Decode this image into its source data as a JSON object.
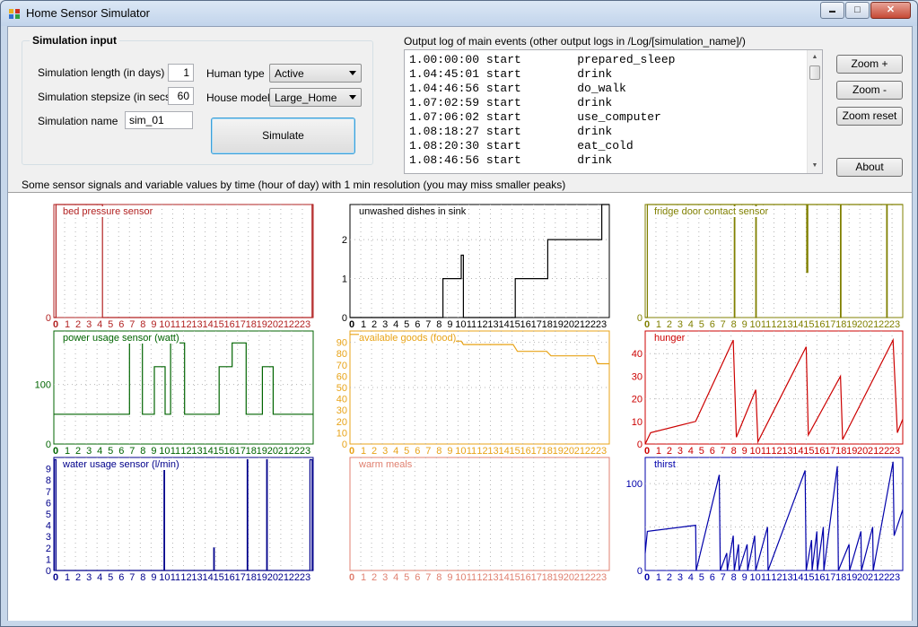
{
  "window": {
    "title": "Home Sensor Simulator",
    "minimize_glyph": "▬",
    "maximize_glyph": "□",
    "close_glyph": "✕",
    "icon": "app-icon"
  },
  "input": {
    "group_title": "Simulation input",
    "length_label": "Simulation length (in days)",
    "length_value": "1",
    "stepsize_label": "Simulation stepsize (in secs)",
    "stepsize_value": "60",
    "name_label": "Simulation name",
    "name_value": "sim_01",
    "human_type_label": "Human type",
    "human_type_value": "Active",
    "house_model_label": "House model",
    "house_model_value": "Large_Home",
    "simulate_label": "Simulate"
  },
  "log": {
    "title": "Output log of main events (other output logs in /Log/[simulation_name]/)",
    "rows": [
      "1.00:00:00 start        prepared_sleep",
      "1.04:45:01 start        drink",
      "1.04:46:56 start        do_walk",
      "1.07:02:59 start        drink",
      "1.07:06:02 start        use_computer",
      "1.08:18:27 start        drink",
      "1.08:20:30 start        eat_cold",
      "1.08:46:56 start        drink"
    ]
  },
  "buttons": {
    "zoom_in": "Zoom +",
    "zoom_out": "Zoom -",
    "zoom_reset": "Zoom reset",
    "about": "About"
  },
  "graphs_caption": "Some sensor signals and variable values by time (hour of day) with 1 min resolution (you may miss smaller peaks)",
  "chart_data": [
    {
      "type": "line",
      "title": "bed pressure sensor",
      "color": "#b22222",
      "xlabel": "",
      "ylabel": "",
      "x_ticks": [
        "0",
        "1",
        "2",
        "3",
        "4",
        "5",
        "6",
        "7",
        "8",
        "9",
        "10",
        "11",
        "12",
        "13",
        "14",
        "15",
        "16",
        "17",
        "18",
        "19",
        "20",
        "21",
        "22",
        "23"
      ],
      "y_ticks": [
        {
          "v": 0,
          "label": "0"
        }
      ],
      "ylim": [
        0,
        1
      ],
      "grid_h": [],
      "x": [
        0,
        0.2,
        0.2,
        4.5,
        4.5,
        23.9,
        23.9,
        24
      ],
      "y": [
        0,
        0,
        1,
        1,
        0,
        0,
        1,
        1
      ]
    },
    {
      "type": "line",
      "title": "unwashed dishes in sink",
      "color": "#000000",
      "xlabel": "",
      "ylabel": "",
      "x_ticks": [
        "0",
        "1",
        "2",
        "3",
        "4",
        "5",
        "6",
        "7",
        "8",
        "9",
        "10",
        "11",
        "12",
        "13",
        "14",
        "15",
        "16",
        "17",
        "18",
        "19",
        "20",
        "21",
        "22",
        "23"
      ],
      "y_ticks": [
        {
          "v": 0,
          "label": "0"
        },
        {
          "v": 1,
          "label": "1"
        },
        {
          "v": 2,
          "label": "2"
        }
      ],
      "ylim": [
        0,
        2.9
      ],
      "grid_h": [
        1,
        2
      ],
      "x": [
        0,
        8.6,
        8.6,
        10.3,
        10.3,
        10.5,
        10.5,
        15.3,
        15.3,
        18.3,
        18.3,
        23.3,
        23.3,
        24
      ],
      "y": [
        0,
        0,
        1,
        1,
        1.6,
        1.6,
        0,
        0,
        1,
        1,
        2,
        2,
        2.9,
        2.9
      ]
    },
    {
      "type": "line",
      "title": "fridge door contact sensor",
      "color": "#808000",
      "xlabel": "",
      "ylabel": "",
      "x_ticks": [
        "0",
        "1",
        "2",
        "3",
        "4",
        "5",
        "6",
        "7",
        "8",
        "9",
        "10",
        "11",
        "12",
        "13",
        "14",
        "15",
        "16",
        "17",
        "18",
        "19",
        "20",
        "21",
        "22",
        "23"
      ],
      "y_ticks": [
        {
          "v": 0,
          "label": "0"
        }
      ],
      "ylim": [
        0,
        1
      ],
      "grid_h": [],
      "x": [
        0,
        0.2,
        0.2,
        8.3,
        8.3,
        8.35,
        8.35,
        10.3,
        10.3,
        10.35,
        10.35,
        15.05,
        15.05,
        15.15,
        15.15,
        18.2,
        18.2,
        18.25,
        18.25,
        22.5,
        22.5,
        22.55,
        22.55,
        24
      ],
      "y": [
        0,
        0,
        1,
        1,
        0,
        0,
        1,
        1,
        0,
        0,
        1,
        1,
        0.4,
        0.4,
        1,
        1,
        0,
        0,
        1,
        1,
        0,
        0,
        1,
        1
      ]
    },
    {
      "type": "line",
      "title": "power usage sensor (watt)",
      "color": "#006400",
      "xlabel": "",
      "ylabel": "",
      "x_ticks": [
        "0",
        "1",
        "2",
        "3",
        "4",
        "5",
        "6",
        "7",
        "8",
        "9",
        "10",
        "11",
        "12",
        "13",
        "14",
        "15",
        "16",
        "17",
        "18",
        "19",
        "20",
        "21",
        "22",
        "23"
      ],
      "y_ticks": [
        {
          "v": 0,
          "label": "0"
        },
        {
          "v": 100,
          "label": "100"
        }
      ],
      "ylim": [
        0,
        190
      ],
      "grid_h": [
        100
      ],
      "x": [
        0,
        7,
        7,
        8.2,
        8.2,
        9.3,
        9.3,
        10.3,
        10.3,
        10.8,
        10.8,
        12.1,
        12.1,
        15.3,
        15.3,
        16.5,
        16.5,
        17.8,
        17.8,
        19.3,
        19.3,
        20.3,
        20.3,
        24
      ],
      "y": [
        50,
        50,
        170,
        170,
        50,
        50,
        130,
        130,
        50,
        50,
        170,
        170,
        50,
        50,
        130,
        130,
        170,
        170,
        50,
        50,
        130,
        130,
        50,
        50
      ]
    },
    {
      "type": "line",
      "title": "available goods (food)",
      "color": "#e8a317",
      "xlabel": "",
      "ylabel": "",
      "x_ticks": [
        "0",
        "1",
        "2",
        "3",
        "4",
        "5",
        "6",
        "7",
        "8",
        "9",
        "10",
        "11",
        "12",
        "13",
        "14",
        "15",
        "16",
        "17",
        "18",
        "19",
        "20",
        "21",
        "22",
        "23"
      ],
      "y_ticks": [
        {
          "v": 0,
          "label": "0"
        },
        {
          "v": 10,
          "label": "10"
        },
        {
          "v": 20,
          "label": "20"
        },
        {
          "v": 30,
          "label": "30"
        },
        {
          "v": 40,
          "label": "40"
        },
        {
          "v": 50,
          "label": "50"
        },
        {
          "v": 60,
          "label": "60"
        },
        {
          "v": 70,
          "label": "70"
        },
        {
          "v": 80,
          "label": "80"
        },
        {
          "v": 90,
          "label": "90"
        }
      ],
      "ylim": [
        0,
        100
      ],
      "grid_h": [
        50,
        90
      ],
      "x": [
        0,
        8.3,
        8.9,
        10.3,
        10.5,
        15.1,
        15.5,
        18.2,
        18.6,
        22.6,
        22.9,
        24
      ],
      "y": [
        97,
        97,
        91,
        91,
        88,
        88,
        82,
        82,
        78,
        78,
        71,
        71
      ]
    },
    {
      "type": "line",
      "title": "hunger",
      "color": "#cc0000",
      "xlabel": "",
      "ylabel": "",
      "x_ticks": [
        "0",
        "1",
        "2",
        "3",
        "4",
        "5",
        "6",
        "7",
        "8",
        "9",
        "10",
        "11",
        "12",
        "13",
        "14",
        "15",
        "16",
        "17",
        "18",
        "19",
        "20",
        "21",
        "22",
        "23"
      ],
      "y_ticks": [
        {
          "v": 0,
          "label": "0"
        },
        {
          "v": 10,
          "label": "10"
        },
        {
          "v": 20,
          "label": "20"
        },
        {
          "v": 30,
          "label": "30"
        },
        {
          "v": 40,
          "label": "40"
        }
      ],
      "ylim": [
        0,
        50
      ],
      "grid_h": [
        20,
        40
      ],
      "x": [
        0,
        0.5,
        4.7,
        8.2,
        8.5,
        10.3,
        10.5,
        15.0,
        15.2,
        18.2,
        18.4,
        23.1,
        23.5,
        24
      ],
      "y": [
        0,
        5,
        10,
        46,
        3,
        24,
        1,
        43,
        4,
        30,
        2,
        46,
        5,
        11
      ]
    },
    {
      "type": "line",
      "title": "water usage sensor (l/min)",
      "color": "#00008b",
      "xlabel": "",
      "ylabel": "",
      "x_ticks": [
        "0",
        "1",
        "2",
        "3",
        "4",
        "5",
        "6",
        "7",
        "8",
        "9",
        "10",
        "11",
        "12",
        "13",
        "14",
        "15",
        "16",
        "17",
        "18",
        "19",
        "20",
        "21",
        "22",
        "23"
      ],
      "y_ticks": [
        {
          "v": 0,
          "label": "0"
        },
        {
          "v": 1,
          "label": "1"
        },
        {
          "v": 2,
          "label": "2"
        },
        {
          "v": 3,
          "label": "3"
        },
        {
          "v": 4,
          "label": "4"
        },
        {
          "v": 5,
          "label": "5"
        },
        {
          "v": 6,
          "label": "6"
        },
        {
          "v": 7,
          "label": "7"
        },
        {
          "v": 8,
          "label": "8"
        },
        {
          "v": 9,
          "label": "9"
        }
      ],
      "ylim": [
        0,
        10
      ],
      "grid_h": [],
      "x": [
        0,
        0.05,
        0.05,
        0.2,
        0.2,
        10.2,
        10.2,
        10.25,
        10.25,
        14.8,
        14.8,
        14.85,
        14.85,
        17.9,
        17.9,
        17.95,
        17.95,
        19.7,
        19.7,
        19.75,
        19.75,
        23.7,
        23.7,
        23.9,
        23.9,
        24
      ],
      "y": [
        0,
        0,
        9.8,
        9.8,
        0,
        0,
        9.8,
        9.8,
        0,
        0,
        2,
        2,
        0,
        0,
        9.8,
        9.8,
        0,
        0,
        9.8,
        9.8,
        0,
        0,
        9.8,
        9.8,
        0,
        0
      ]
    },
    {
      "type": "line",
      "title": "warm meals",
      "color": "#e08070",
      "xlabel": "",
      "ylabel": "",
      "x_ticks": [
        "0",
        "1",
        "2",
        "3",
        "4",
        "5",
        "6",
        "7",
        "8",
        "9",
        "10",
        "11",
        "12",
        "13",
        "14",
        "15",
        "16",
        "17",
        "18",
        "19",
        "20",
        "21",
        "22",
        "23"
      ],
      "y_ticks": [],
      "ylim": [
        0,
        1
      ],
      "grid_h": [],
      "x": [],
      "y": []
    },
    {
      "type": "line",
      "title": "thirst",
      "color": "#0000aa",
      "xlabel": "",
      "ylabel": "",
      "x_ticks": [
        "0",
        "1",
        "2",
        "3",
        "4",
        "5",
        "6",
        "7",
        "8",
        "9",
        "10",
        "11",
        "12",
        "13",
        "14",
        "15",
        "16",
        "17",
        "18",
        "19",
        "20",
        "21",
        "22",
        "23"
      ],
      "y_ticks": [
        {
          "v": 0,
          "label": "0"
        },
        {
          "v": 100,
          "label": "100"
        }
      ],
      "ylim": [
        0,
        130
      ],
      "grid_h": [
        50,
        100
      ],
      "x": [
        0,
        0.2,
        4.7,
        4.75,
        6.9,
        7.0,
        7.6,
        7.65,
        8.2,
        8.3,
        8.7,
        8.75,
        9.5,
        9.55,
        10.2,
        10.3,
        11.4,
        11.45,
        14.9,
        15.0,
        15.5,
        15.55,
        16.0,
        16.05,
        16.6,
        16.65,
        17.9,
        18.0,
        19.0,
        19.05,
        20.1,
        20.15,
        21.2,
        21.25,
        23.1,
        23.2,
        24
      ],
      "y": [
        20,
        45,
        52,
        0,
        110,
        0,
        20,
        0,
        40,
        0,
        30,
        0,
        30,
        0,
        40,
        0,
        50,
        0,
        115,
        0,
        35,
        0,
        45,
        0,
        50,
        0,
        120,
        0,
        30,
        0,
        45,
        0,
        50,
        0,
        125,
        40,
        70
      ]
    }
  ]
}
